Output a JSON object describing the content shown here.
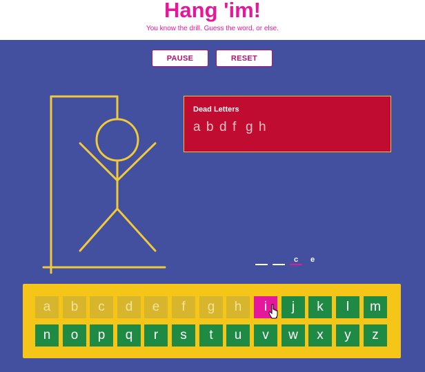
{
  "header": {
    "title": "Hang 'im!",
    "subtitle": "You know the drill. Guess the word, or else."
  },
  "controls": {
    "pause_label": "PAUSE",
    "reset_label": "RESET"
  },
  "dead_letters": {
    "title": "Dead Letters",
    "letters": [
      "a",
      "b",
      "d",
      "f",
      "g",
      "h"
    ]
  },
  "word": {
    "slots": [
      "",
      "",
      "c",
      "e"
    ]
  },
  "keyboard": {
    "row1": [
      "a",
      "b",
      "c",
      "d",
      "e",
      "f",
      "g",
      "h",
      "i",
      "j",
      "k",
      "l",
      "m"
    ],
    "row2": [
      "n",
      "o",
      "p",
      "q",
      "r",
      "s",
      "t",
      "u",
      "v",
      "w",
      "x",
      "y",
      "z"
    ],
    "used": [
      "a",
      "b",
      "c",
      "d",
      "e",
      "f",
      "g",
      "h"
    ],
    "active": "i"
  },
  "colors": {
    "background": "#4350a0",
    "accent": "#e5189b",
    "gallows": "#f0c93c",
    "dead_panel": "#c00c30",
    "key_available": "#1e8a44",
    "key_used": "#d7b62d",
    "keyboard_bg": "#f5c518"
  }
}
